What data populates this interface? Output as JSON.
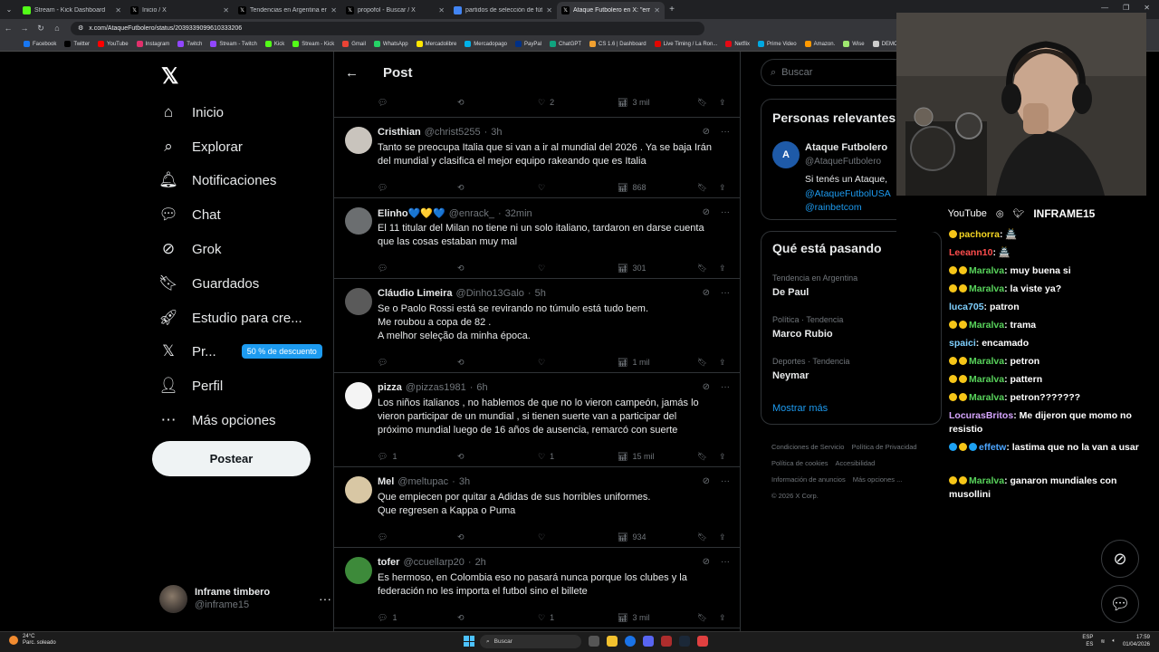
{
  "browser": {
    "tabs": [
      {
        "title": "Stream - Kick Dashboard",
        "icon_color": "#53fc18",
        "active": false
      },
      {
        "title": "Inicio / X",
        "icon_color": "#000000",
        "active": false
      },
      {
        "title": "Tendencias en Argentina en X",
        "icon_color": "#000000",
        "active": false
      },
      {
        "title": "propofol - Buscar / X",
        "icon_color": "#000000",
        "active": false
      },
      {
        "title": "partidos de selección de fútbol",
        "icon_color": "#4285f4",
        "active": false
      },
      {
        "title": "Ataque Futbolero en X: \"error l",
        "icon_color": "#000000",
        "active": true
      }
    ],
    "url": "x.com/AtaqueFutbolero/status/2039339099610333206",
    "bookmarks": [
      {
        "label": "Facebook",
        "color": "#1877f2"
      },
      {
        "label": "Twitter",
        "color": "#000000"
      },
      {
        "label": "YouTube",
        "color": "#ff0000"
      },
      {
        "label": "Instagram",
        "color": "#e1306c"
      },
      {
        "label": "Twitch",
        "color": "#9146ff"
      },
      {
        "label": "Stream - Twitch",
        "color": "#9146ff"
      },
      {
        "label": "Kick",
        "color": "#53fc18"
      },
      {
        "label": "Stream - Kick",
        "color": "#53fc18"
      },
      {
        "label": "Gmail",
        "color": "#ea4335"
      },
      {
        "label": "WhatsApp",
        "color": "#25d366"
      },
      {
        "label": "Mercadolibre",
        "color": "#ffe600"
      },
      {
        "label": "Mercadopago",
        "color": "#00b1ea"
      },
      {
        "label": "PayPal",
        "color": "#003087"
      },
      {
        "label": "ChatGPT",
        "color": "#10a37f"
      },
      {
        "label": "CS 1.6 | Dashboard",
        "color": "#f0a030"
      },
      {
        "label": "Live Timing / La Ron...",
        "color": "#e10600"
      },
      {
        "label": "Netflix",
        "color": "#e50914"
      },
      {
        "label": "Prime Video",
        "color": "#00a8e1"
      },
      {
        "label": "Amazon.",
        "color": "#ff9900"
      },
      {
        "label": "Wise",
        "color": "#9fe870"
      },
      {
        "label": "DEMOS",
        "color": "#cccccc"
      }
    ]
  },
  "nav": {
    "items": [
      {
        "label": "Inicio",
        "icon": "home-icon"
      },
      {
        "label": "Explorar",
        "icon": "search-icon"
      },
      {
        "label": "Notificaciones",
        "icon": "bell-icon"
      },
      {
        "label": "Chat",
        "icon": "chat-bubble-icon"
      },
      {
        "label": "Grok",
        "icon": "grok-icon"
      },
      {
        "label": "Guardados",
        "icon": "bookmark-icon"
      },
      {
        "label": "Estudio para cre...",
        "icon": "rocket-icon"
      },
      {
        "label": "Pr...",
        "icon": "x-premium-icon",
        "badge": "50 % de descuento"
      },
      {
        "label": "Perfil",
        "icon": "person-icon"
      },
      {
        "label": "Más opciones",
        "icon": "more-circle-icon"
      }
    ],
    "post_button": "Postear",
    "account": {
      "name": "Inframe timbero",
      "handle": "@inframe15"
    }
  },
  "post": {
    "header_title": "Post",
    "top_actions": {
      "likes": "2",
      "views": "3 mil"
    },
    "replies": [
      {
        "name": "Cristhian",
        "handle": "@christ5255",
        "time": "3h",
        "avatar_color": "#c9c4bd",
        "lines": [
          "Tanto se preocupa Italia que si van a ir al mundial del 2026 . Ya se baja Irán",
          "del mundial y clasifica el mejor equipo rakeando que es Italia"
        ],
        "replies_count": "",
        "likes": "",
        "views": "868"
      },
      {
        "name": "Elinho💙💛💙",
        "handle": "@enrack_",
        "time": "32min",
        "avatar_color": "#6b6e70",
        "lines": [
          "El 11 titular del Milan no tiene ni un solo italiano, tardaron en darse cuenta",
          "que las cosas estaban muy mal"
        ],
        "replies_count": "",
        "likes": "",
        "views": "301"
      },
      {
        "name": "Cláudio Limeira",
        "handle": "@Dinho13Galo",
        "time": "5h",
        "avatar_color": "#5a5a5a",
        "lines": [
          "Se o Paolo Rossi está se revirando no túmulo está tudo bem.",
          "Me roubou a copa de 82 .",
          "A melhor seleção da minha época."
        ],
        "replies_count": "",
        "likes": "",
        "views": "1 mil"
      },
      {
        "name": "pizza",
        "handle": "@pizzas1981",
        "time": "6h",
        "avatar_color": "#f4f4f4",
        "lines": [
          "Los niños italianos ,  no hablemos de que no lo vieron campeón, jamás lo",
          "vieron participar de un mundial , si tienen suerte van a participar del",
          "próximo mundial luego de 16 años de ausencia, remarcó con suerte"
        ],
        "replies_count": "1",
        "likes": "1",
        "views": "15 mil"
      },
      {
        "name": "Mel",
        "handle": "@meltupac",
        "time": "3h",
        "avatar_color": "#d8c7a4",
        "lines": [
          "Que empiecen por quitar a Adidas de sus horribles uniformes.",
          "Que regresen a Kappa o Puma"
        ],
        "replies_count": "",
        "likes": "",
        "views": "934"
      },
      {
        "name": "tofer",
        "handle": "@ccuellarp20",
        "time": "2h",
        "avatar_color": "#3d8a3a",
        "lines": [
          "Es hermoso, en Colombia eso no pasará nunca porque los clubes y la",
          "federación no les importa el futbol sino el billete"
        ],
        "replies_count": "1",
        "likes": "1",
        "views": "3 mil"
      }
    ]
  },
  "right": {
    "search_placeholder": "Buscar",
    "relevant_title": "Personas relevantes",
    "relevant": {
      "name": "Ataque Futbolero",
      "handle": "@AtaqueFutbolero",
      "bio_1": "Si tenés un Ataque,",
      "bio_2": "@AtaqueFutbolUSA",
      "bio_3": "@rainbetcom"
    },
    "trends_title": "Qué está pasando",
    "trends": [
      {
        "category": "Tendencia en Argentina",
        "name": "De Paul"
      },
      {
        "category": "Política · Tendencia",
        "name": "Marco Rubio"
      },
      {
        "category": "Deportes · Tendencia",
        "name": "Neymar"
      }
    ],
    "show_more": "Mostrar más",
    "footer": [
      "Condiciones de Servicio",
      "Política de Privacidad",
      "Política de cookies",
      "Accesibilidad",
      "Información de anuncios",
      "Más opciones ...",
      "© 2026 X Corp."
    ]
  },
  "stream": {
    "youtube": "YouTube",
    "channel": "INFRAME15",
    "chat": [
      {
        "user": "pachorra",
        "msg": ": 🏯",
        "color": "#f5d623",
        "badges": [
          "#f5c518"
        ]
      },
      {
        "user": "Leeann10",
        "msg": ": 🏯",
        "color": "#ff4d4d",
        "badges": []
      },
      {
        "user": "Maralva",
        "msg": ": muy buena si",
        "color": "#58d35b",
        "badges": [
          "#f5c518",
          "#f5c518"
        ]
      },
      {
        "user": "Maralva",
        "msg": ": la viste ya?",
        "color": "#58d35b",
        "badges": [
          "#f5c518",
          "#f5c518"
        ]
      },
      {
        "user": "luca705",
        "msg": ": patron",
        "color": "#7fd0ff",
        "badges": []
      },
      {
        "user": "Maralva",
        "msg": ": trama",
        "color": "#58d35b",
        "badges": [
          "#f5c518",
          "#f5c518"
        ]
      },
      {
        "user": "spaici",
        "msg": ": encamado",
        "color": "#7fd0ff",
        "badges": []
      },
      {
        "user": "Maralva",
        "msg": ": petron",
        "color": "#58d35b",
        "badges": [
          "#f5c518",
          "#f5c518"
        ]
      },
      {
        "user": "Maralva",
        "msg": ": pattern",
        "color": "#58d35b",
        "badges": [
          "#f5c518",
          "#f5c518"
        ]
      },
      {
        "user": "Maralva",
        "msg": ": petron???????",
        "color": "#58d35b",
        "badges": [
          "#f5c518",
          "#f5c518"
        ]
      },
      {
        "user": "LocurasBritos",
        "msg": ": Me dijeron que momo no resistio",
        "color": "#d7a6ff",
        "badges": []
      },
      {
        "user": "effetw",
        "msg": ": lastima que no la van a usar",
        "color": "#4da6ff",
        "badges": [
          "#1da1f2",
          "#f5c518",
          "#1da1f2"
        ]
      },
      {
        "user": "Maralva",
        "msg": ": ganaron mundiales con musollini",
        "color": "#58d35b",
        "badges": [
          "#f5c518",
          "#f5c518"
        ]
      }
    ]
  },
  "taskbar": {
    "weather_temp": "24°C",
    "weather_desc": "Parc. soleado",
    "search": "Buscar",
    "lang_1": "ESP",
    "lang_2": "ES",
    "time": "17:59",
    "date": "01/04/2026"
  }
}
